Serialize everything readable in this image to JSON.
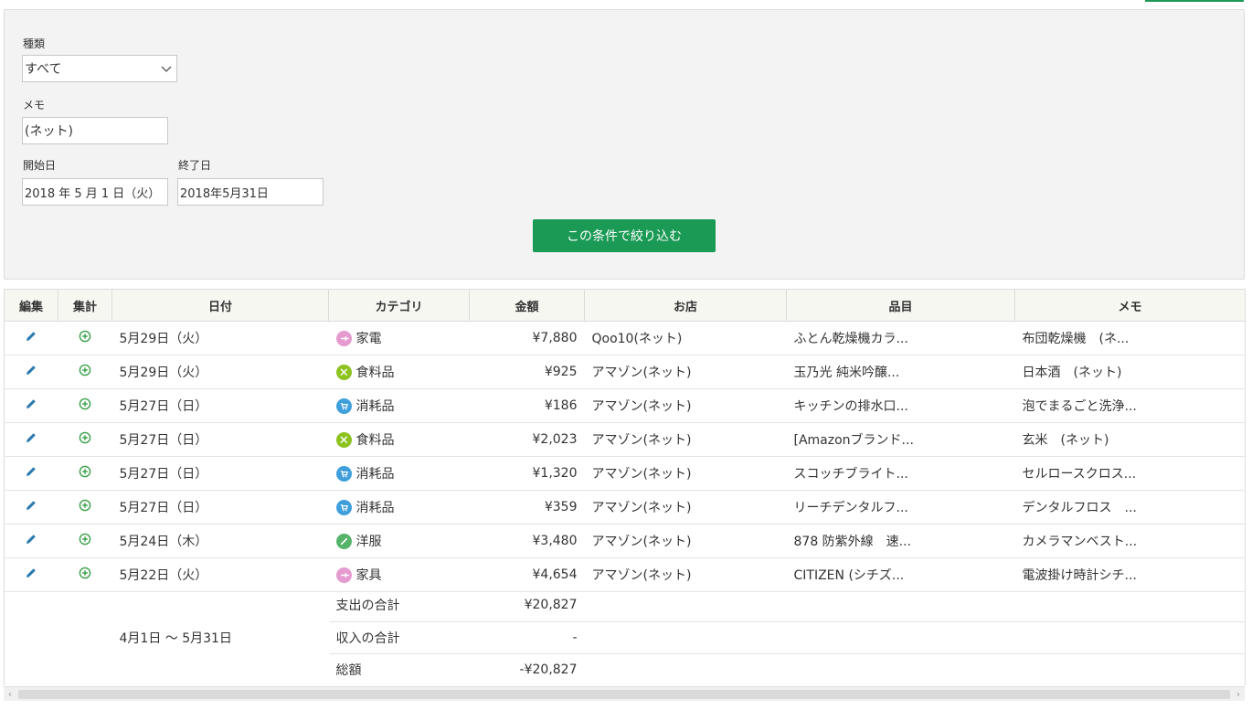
{
  "filter": {
    "type_label": "種類",
    "type_value": "すべて",
    "memo_label": "メモ",
    "memo_value": "(ネット)",
    "start_label": "開始日",
    "start_value": "2018 年 5 月 1 日（火）",
    "end_label": "終了日",
    "end_value": "2018年5月31日",
    "submit_label": "この条件で絞り込む"
  },
  "table": {
    "headers": [
      "編集",
      "集計",
      "日付",
      "カテゴリ",
      "金額",
      "お店",
      "品目",
      "メモ"
    ],
    "rows": [
      {
        "date": "5月29日（火）",
        "category": "家電",
        "amount": "¥7,880",
        "shop": "Qoo10(ネット)",
        "item": "ふとん乾燥機カラ...",
        "memo": "布団乾燥機　(ネ..."
      },
      {
        "date": "5月29日（火）",
        "category": "食料品",
        "amount": "¥925",
        "shop": "アマゾン(ネット)",
        "item": "玉乃光 純米吟醸...",
        "memo": "日本酒　(ネット)"
      },
      {
        "date": "5月27日（日）",
        "category": "消耗品",
        "amount": "¥186",
        "shop": "アマゾン(ネット)",
        "item": "キッチンの排水口...",
        "memo": "泡でまるごと洗浄..."
      },
      {
        "date": "5月27日（日）",
        "category": "食料品",
        "amount": "¥2,023",
        "shop": "アマゾン(ネット)",
        "item": "[Amazonブランド...",
        "memo": "玄米　(ネット)"
      },
      {
        "date": "5月27日（日）",
        "category": "消耗品",
        "amount": "¥1,320",
        "shop": "アマゾン(ネット)",
        "item": "スコッチブライト...",
        "memo": "セルロースクロス..."
      },
      {
        "date": "5月27日（日）",
        "category": "消耗品",
        "amount": "¥359",
        "shop": "アマゾン(ネット)",
        "item": "リーチデンタルフ...",
        "memo": "デンタルフロス　..."
      },
      {
        "date": "5月24日（木）",
        "category": "洋服",
        "amount": "¥3,480",
        "shop": "アマゾン(ネット)",
        "item": "878 防紫外線　速...",
        "memo": "カメラマンベスト..."
      },
      {
        "date": "5月22日（火）",
        "category": "家具",
        "amount": "¥4,654",
        "shop": "アマゾン(ネット)",
        "item": "CITIZEN (シチズ...",
        "memo": "電波掛け時計シチ..."
      }
    ]
  },
  "summary": {
    "period": "4月1日 ～ 5月31日",
    "expense_label": "支出の合計",
    "expense_value": "¥20,827",
    "income_label": "収入の合計",
    "income_value": "-",
    "total_label": "総額",
    "total_value": "-¥20,827"
  },
  "icons": {
    "edit": "pencil-icon",
    "aggregate": "circle-plus-icon",
    "categories": {
      "家電": {
        "color": "#e59ad0",
        "icon": "plug-icon"
      },
      "家具": {
        "color": "#e59ad0",
        "icon": "plug-icon"
      },
      "食料品": {
        "color": "#8dc21f",
        "icon": "utensils-icon"
      },
      "消耗品": {
        "color": "#3f9fdc",
        "icon": "cart-icon"
      },
      "洋服": {
        "color": "#56b36a",
        "icon": "hanger-icon"
      }
    }
  },
  "colors": {
    "accent": "#1a9a54",
    "edit_icon": "#2a7ab0",
    "aggregate_icon": "#3aa04a"
  }
}
